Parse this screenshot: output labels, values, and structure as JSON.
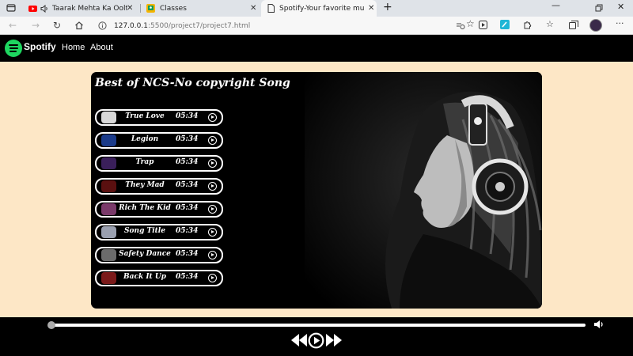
{
  "browser": {
    "tabs": [
      {
        "title": "Taarak Mehta Ka Ooltah Ch"
      },
      {
        "title": "Classes"
      },
      {
        "title": "Spotify-Your favorite music is he"
      }
    ],
    "new_tab": "+",
    "url_host": "127.0.0.1",
    "url_path": ":5500/project7/project7.html"
  },
  "site": {
    "brand": "Spotify",
    "nav": [
      "Home",
      "About"
    ]
  },
  "playlist": {
    "heading": "Best of NCS-No copyright Song",
    "songs": [
      {
        "name": "True Love",
        "duration": "05:34",
        "thumb_color": "#d9d9d9"
      },
      {
        "name": "Legion",
        "duration": "05:34",
        "thumb_color": "#1b3b8a"
      },
      {
        "name": "Trap",
        "duration": "05:34",
        "thumb_color": "#3a1f5a"
      },
      {
        "name": "They Mad",
        "duration": "05:34",
        "thumb_color": "#5a1010"
      },
      {
        "name": "Rich The Kid",
        "duration": "05:34",
        "thumb_color": "#7a3a6a"
      },
      {
        "name": "Song Title",
        "duration": "05:34",
        "thumb_color": "#9aa0b0"
      },
      {
        "name": "Safety Dance",
        "duration": "05:34",
        "thumb_color": "#6b6b6b"
      },
      {
        "name": "Back It Up",
        "duration": "05:34",
        "thumb_color": "#7a1a1a"
      }
    ]
  },
  "player": {
    "progress": 0
  },
  "icons": {
    "youtube": "youtube-icon",
    "classroom": "classroom-icon",
    "audio": "speaker-icon",
    "play": "play-circle-icon",
    "prev": "backward-icon",
    "next": "forward-icon",
    "volume": "volume-icon"
  }
}
